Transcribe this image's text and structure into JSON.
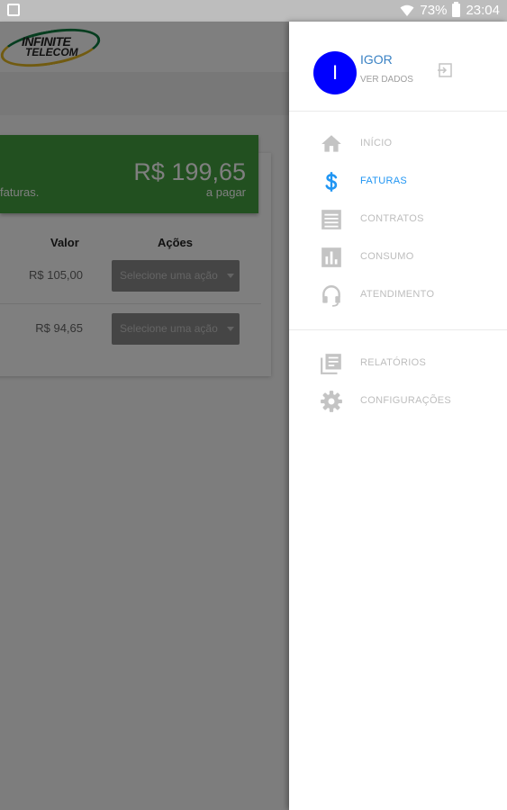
{
  "status_bar": {
    "battery": "73%",
    "time": "23:04"
  },
  "logo": {
    "line1": "INFINITE",
    "line2": "TELECOM"
  },
  "summary": {
    "amount": "R$ 199,65",
    "amount_caption": "a pagar",
    "description_fragment": "faturas."
  },
  "table": {
    "headers": [
      "Valor",
      "Ações"
    ],
    "rows": [
      {
        "value": "R$ 105,00",
        "action": "Selecione uma ação"
      },
      {
        "value": "R$ 94,65",
        "action": "Selecione uma ação"
      }
    ]
  },
  "drawer": {
    "user": {
      "initial": "I",
      "name": "IGOR",
      "subtitle": "VER DADOS"
    },
    "items": [
      {
        "label": "INÍCIO",
        "icon": "home-icon",
        "active": false
      },
      {
        "label": "FATURAS",
        "icon": "dollar-icon",
        "active": true
      },
      {
        "label": "CONTRATOS",
        "icon": "list-icon",
        "active": false
      },
      {
        "label": "CONSUMO",
        "icon": "bar-chart-icon",
        "active": false
      },
      {
        "label": "ATENDIMENTO",
        "icon": "headset-icon",
        "active": false
      },
      {
        "label": "RELATÓRIOS",
        "icon": "reports-icon",
        "active": false
      },
      {
        "label": "CONFIGURAÇÕES",
        "icon": "gear-icon",
        "active": false
      }
    ]
  },
  "colors": {
    "accent": "#2196f3",
    "avatar": "#0000ff",
    "banner": "#44a040",
    "icon_gray": "#c4c4c4"
  }
}
